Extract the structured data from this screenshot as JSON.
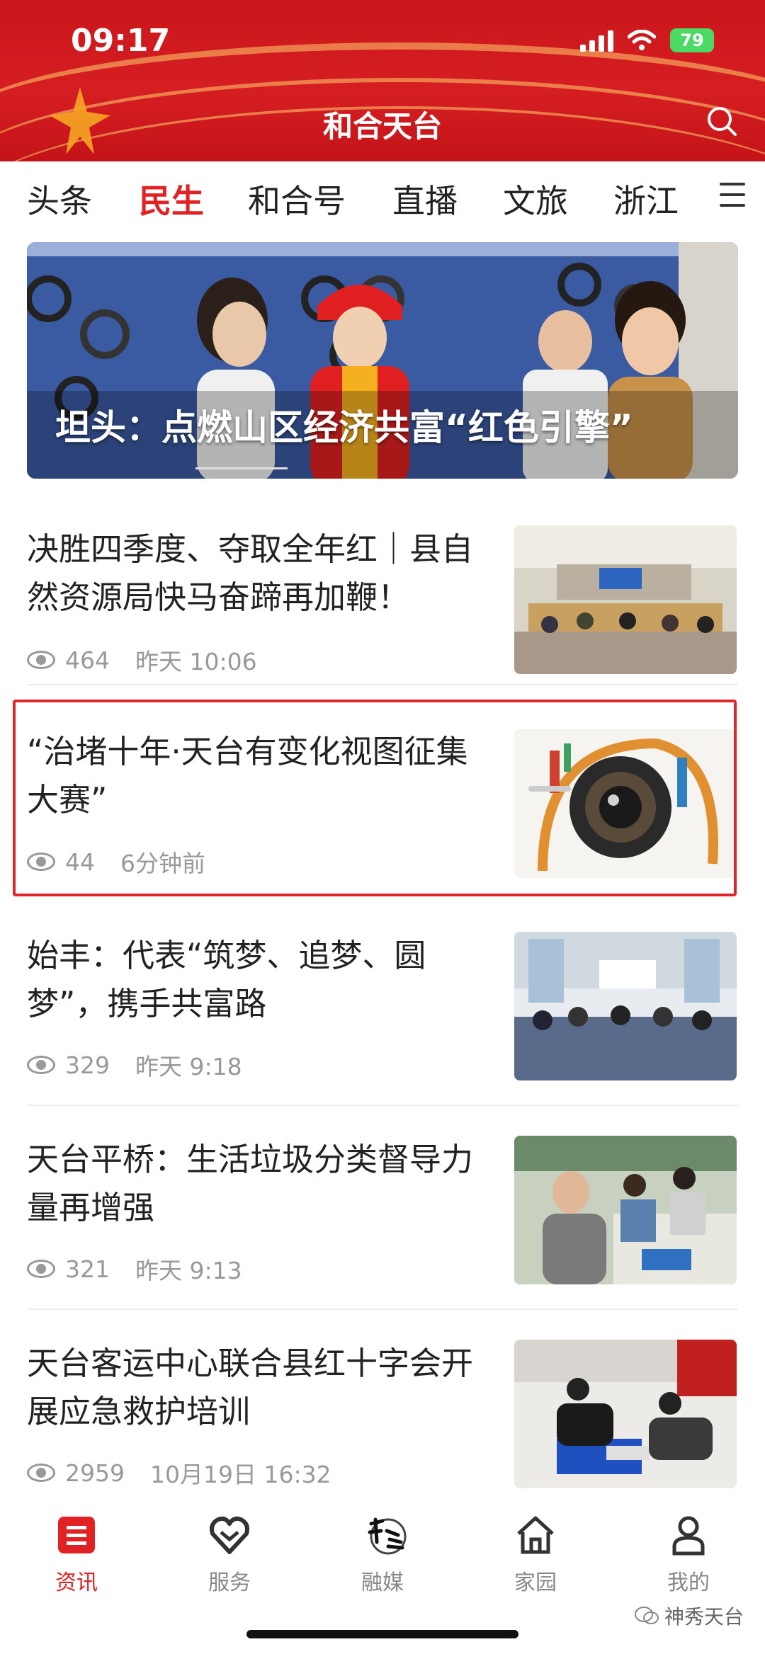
{
  "status": {
    "time": "09:17",
    "battery": "79"
  },
  "header": {
    "title": "和合天台"
  },
  "tabs": [
    "头条",
    "民生",
    "和合号",
    "直播",
    "文旅",
    "浙江"
  ],
  "hero": {
    "title": "坦头：点燃山区经济共富“红色引擎”"
  },
  "news": [
    {
      "title": "决胜四季度、夺取全年红｜县自然资源局快马奋蹄再加鞭！",
      "views": "464",
      "time": "昨天 10:06"
    },
    {
      "title": "“治堵十年·天台有变化视图征集大赛”",
      "views": "44",
      "time": "6分钟前"
    },
    {
      "title": "始丰：代表“筑梦、追梦、圆梦”，携手共富路",
      "views": "329",
      "time": "昨天 9:18"
    },
    {
      "title": "天台平桥：生活垃圾分类督导力量再增强",
      "views": "321",
      "time": "昨天 9:13"
    },
    {
      "title": "天台客运中心联合县红十字会开展应急救护培训",
      "views": "2959",
      "time": "10月19日 16:32"
    }
  ],
  "bottom_nav": [
    "资讯",
    "服务",
    "融媒",
    "家园",
    "我的"
  ],
  "watermark": "神秀天台",
  "colors": {
    "brand_red": "#d61e22",
    "active_red": "#e02225"
  }
}
